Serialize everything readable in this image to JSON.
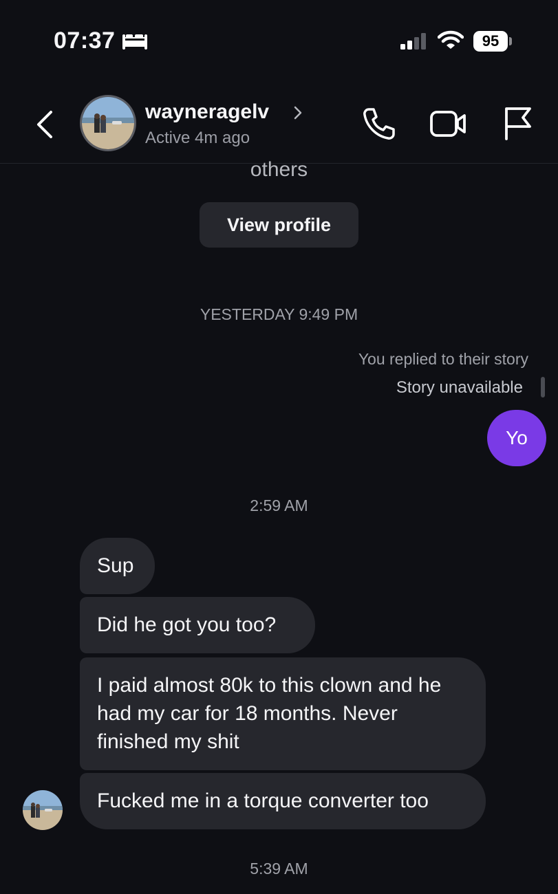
{
  "status_bar": {
    "time": "07:37",
    "battery": "95",
    "icons": [
      "sleep-icon",
      "cellular-signal-icon",
      "wifi-icon",
      "battery-icon"
    ]
  },
  "header": {
    "username": "wayneragelv",
    "status": "Active 4m ago",
    "icons": [
      "back-icon",
      "chevron-right-icon",
      "phone-icon",
      "video-icon",
      "flag-icon"
    ]
  },
  "profile_section": {
    "partial_text": "others",
    "view_profile_label": "View profile"
  },
  "conversation": {
    "timestamp_1": "YESTERDAY 9:49 PM",
    "story_reply_label": "You replied to their story",
    "story_unavailable": "Story unavailable",
    "outgoing_message": "Yo",
    "timestamp_2": "2:59 AM",
    "incoming_messages": [
      "Sup",
      "Did he got you too?",
      "I paid almost 80k to this clown and he had my car for 18 months. Never finished my shit",
      "Fucked me in a torque converter too"
    ],
    "timestamp_3": "5:39 AM"
  },
  "colors": {
    "background": "#0e0f14",
    "incoming_bubble": "#26272d",
    "outgoing_bubble": "#7a3ae6",
    "secondary_text": "#a0a2a9"
  }
}
